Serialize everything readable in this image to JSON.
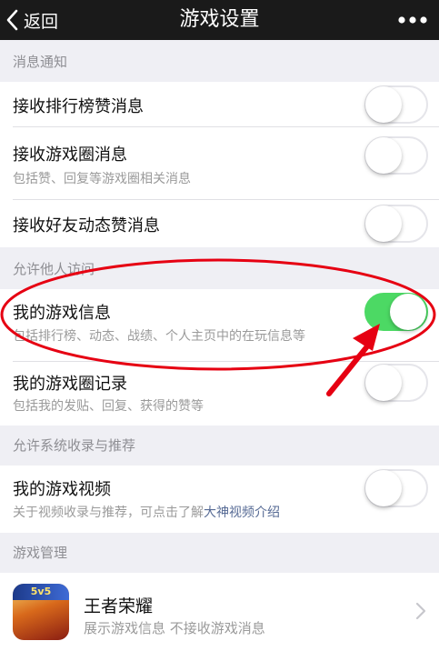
{
  "nav": {
    "back_label": "返回",
    "title": "游戏设置"
  },
  "sections": {
    "notifications": {
      "header": "消息通知",
      "items": [
        {
          "title": "接收排行榜赞消息",
          "subtitle": "",
          "on": false
        },
        {
          "title": "接收游戏圈消息",
          "subtitle": "包括赞、回复等游戏圈相关消息",
          "on": false
        },
        {
          "title": "接收好友动态赞消息",
          "subtitle": "",
          "on": false
        }
      ]
    },
    "visibility": {
      "header": "允许他人访问",
      "items": [
        {
          "title": "我的游戏信息",
          "subtitle": "包括排行榜、动态、战绩、个人主页中的在玩信息等",
          "on": true
        },
        {
          "title": "我的游戏圈记录",
          "subtitle": "包括我的发贴、回复、获得的赞等",
          "on": false
        }
      ]
    },
    "recommendation": {
      "header": "允许系统收录与推荐",
      "items": [
        {
          "title": "我的游戏视频",
          "subtitle_prefix": "关于视频收录与推荐，可点击了解",
          "subtitle_link": "大神视频介绍",
          "on": false
        }
      ]
    },
    "management": {
      "header": "游戏管理",
      "game": {
        "name": "王者荣耀",
        "subtitle": "展示游戏信息 不接收游戏消息",
        "icon_badge": "5v5"
      }
    }
  },
  "colors": {
    "toggle_on": "#4cd964",
    "annotation": "#e60012",
    "topbar": "#1a1a1a",
    "link": "#576b95"
  }
}
